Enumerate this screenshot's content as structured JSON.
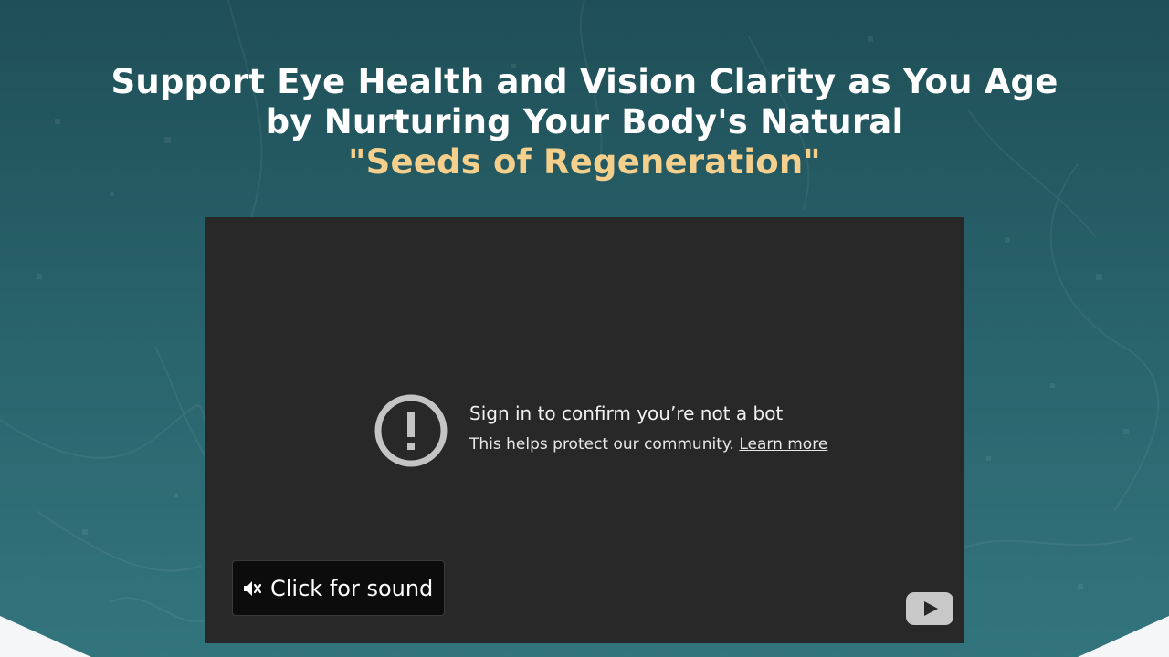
{
  "headline": {
    "line1": "Support Eye Health and Vision Clarity as You Age",
    "line2": "by Nurturing Your Body's Natural",
    "line3": "\"Seeds of Regeneration\""
  },
  "video": {
    "error_title": "Sign in to confirm you’re not a bot",
    "error_message": "This helps protect our community.",
    "learn_more": "Learn more",
    "sound_button_label": "Click for sound"
  },
  "icons": {
    "error": "alert-circle-icon",
    "mute": "speaker-muted-icon",
    "youtube": "youtube-logo-icon"
  },
  "colors": {
    "accent": "#f5cf8c",
    "background_top": "#1f4f57",
    "background_bottom": "#33757d",
    "video_bg": "#282828"
  }
}
